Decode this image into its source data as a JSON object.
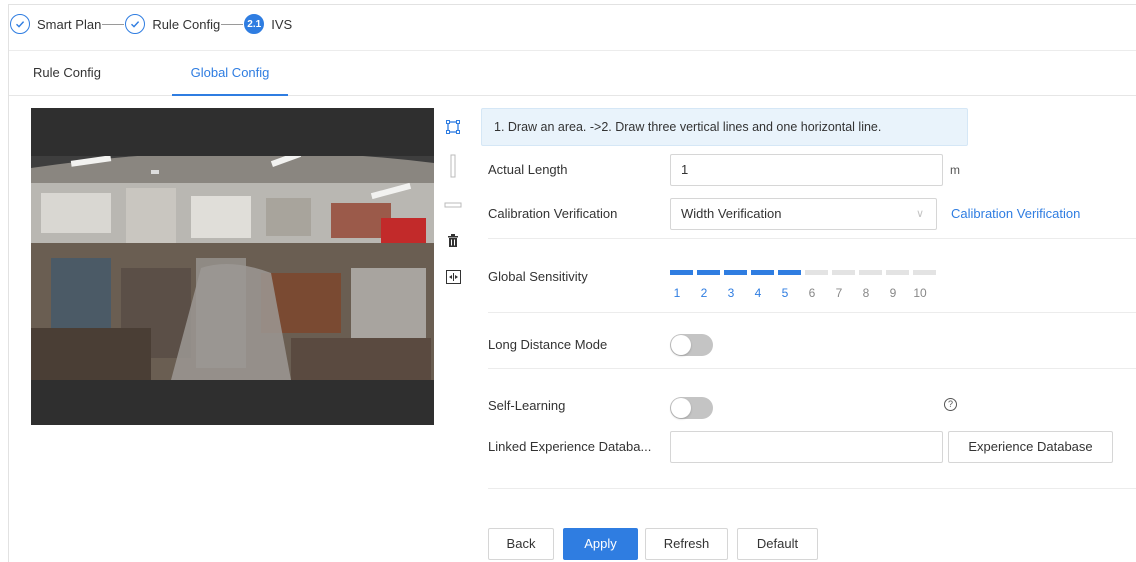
{
  "steps": [
    {
      "label": "Smart Plan",
      "state": "done",
      "icon": "check-icon"
    },
    {
      "label": "Rule Config",
      "state": "done",
      "icon": "check-icon"
    },
    {
      "label": "IVS",
      "state": "active",
      "number": "2.1"
    }
  ],
  "tabs": [
    {
      "label": "Rule Config",
      "active": false
    },
    {
      "label": "Global Config",
      "active": true
    }
  ],
  "notice": "1. Draw an area. ->2. Draw three vertical lines and one horizontal line.",
  "form": {
    "actual_length": {
      "label": "Actual Length",
      "value": "1",
      "unit": "m"
    },
    "calibration_verification": {
      "label": "Calibration Verification",
      "value": "Width Verification",
      "link": "Calibration Verification"
    },
    "global_sensitivity": {
      "label": "Global Sensitivity",
      "value": 5,
      "max": 10,
      "ticks": [
        "1",
        "2",
        "3",
        "4",
        "5",
        "6",
        "7",
        "8",
        "9",
        "10"
      ]
    },
    "long_distance_mode": {
      "label": "Long Distance Mode",
      "enabled": false
    },
    "self_learning": {
      "label": "Self-Learning",
      "enabled": false,
      "help_icon": "help-circle-icon"
    },
    "linked_experience_database": {
      "label": "Linked Experience Databa...",
      "value": "",
      "button": "Experience Database"
    }
  },
  "toolbar_icons": [
    "draw-area-icon",
    "vertical-line-icon",
    "horizontal-line-icon",
    "delete-icon",
    "calibration-icon"
  ],
  "buttons": {
    "back": "Back",
    "apply": "Apply",
    "refresh": "Refresh",
    "default": "Default"
  },
  "colors": {
    "accent": "#2f7de1",
    "notice_bg": "#e9f3fb",
    "toggle_off": "#c4c4c4",
    "segment_off": "#e3e3e3"
  }
}
